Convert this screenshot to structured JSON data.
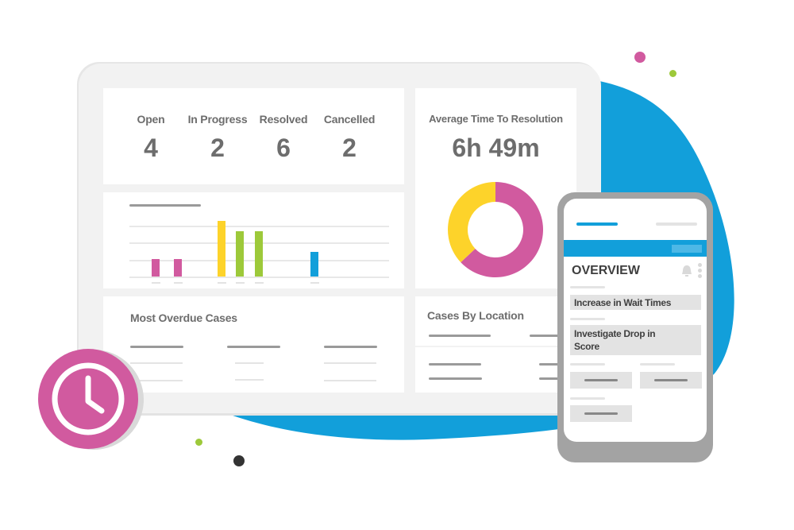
{
  "colors": {
    "blob_blue": "#129fda",
    "magenta": "#d15a9f",
    "yellow": "#fdd32a",
    "green": "#9dc93a",
    "blue": "#129fda",
    "text_gray": "#6d6d6d",
    "dark_dot": "#333333"
  },
  "stats": [
    {
      "label": "Open",
      "value": "4"
    },
    {
      "label": "In Progress",
      "value": "2"
    },
    {
      "label": "Resolved",
      "value": "6"
    },
    {
      "label": "Cancelled",
      "value": "2"
    }
  ],
  "resolution": {
    "title": "Average Time To Resolution",
    "value": "6h 49m"
  },
  "donut": {
    "segments": [
      {
        "name": "magenta",
        "fraction": 0.63,
        "color": "#d15a9f"
      },
      {
        "name": "yellow",
        "fraction": 0.37,
        "color": "#fdd32a"
      }
    ]
  },
  "bar_chart": {
    "bars": [
      {
        "value": 1,
        "color": "#d15a9f"
      },
      {
        "value": 1,
        "color": "#d15a9f"
      },
      {
        "value": 3.2,
        "color": "#fdd32a"
      },
      {
        "value": 2.6,
        "color": "#9dc93a"
      },
      {
        "value": 2.6,
        "color": "#9dc93a"
      },
      {
        "value": 1.4,
        "color": "#129fda"
      }
    ],
    "max": 3.2
  },
  "overdue": {
    "title": "Most Overdue Cases"
  },
  "location": {
    "title": "Cases By Location"
  },
  "phone": {
    "title": "OVERVIEW",
    "cards": [
      {
        "text": "Increase in Wait Times"
      },
      {
        "text": "Investigate Drop in Score"
      }
    ],
    "bell_icon": "bell-icon",
    "more_icon": "kebab-menu-icon"
  },
  "badge": {
    "icon": "clock-icon"
  }
}
